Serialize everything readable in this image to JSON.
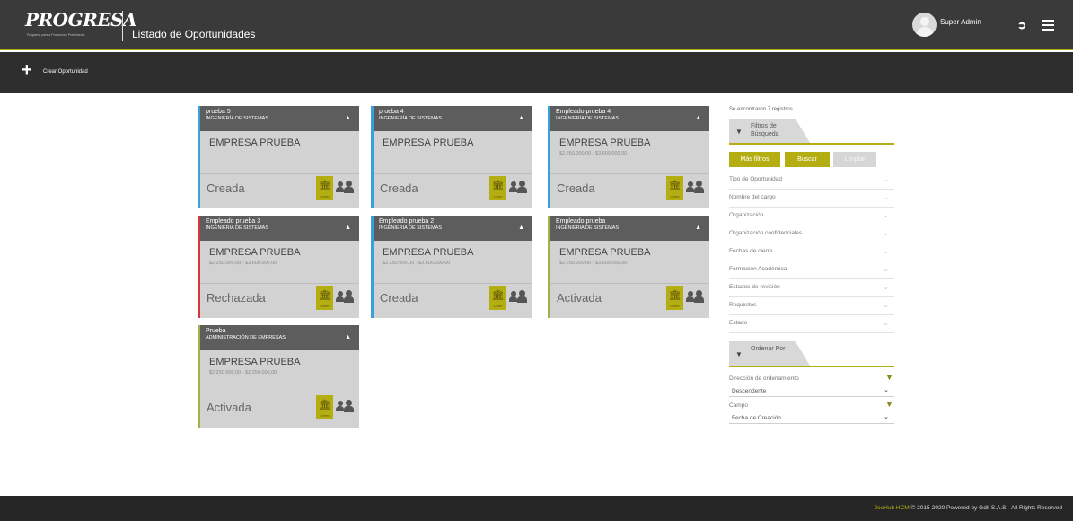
{
  "header": {
    "logo_text": "PROGRESA",
    "logo_tagline": "Programa para a Producción Profesional",
    "page_title": "Listado de Oportunidades",
    "user_name": "Super Admin",
    "accent_color": "#b5ae12"
  },
  "toolbar": {
    "create_label": "Crear Oportunidad"
  },
  "cards": [
    {
      "name": "prueba 5",
      "area": "INGENIERÍA DE SISTEMAS",
      "company": "EMPRESA PRUEBA",
      "salary": "",
      "status": "Creada",
      "bank_label": "Lorem",
      "status_color": "#3aa0d8"
    },
    {
      "name": "prueba 4",
      "area": "INGENIERÍA DE SISTEMAS",
      "company": "EMPRESA PRUEBA",
      "salary": "",
      "status": "Creada",
      "bank_label": "Lorem",
      "status_color": "#3aa0d8"
    },
    {
      "name": "Empleado prueba 4",
      "area": "INGENIERÍA DE SISTEMAS",
      "company": "EMPRESA PRUEBA",
      "salary": "$2.250.000,00 - $3.600.000,00",
      "status": "Creada",
      "bank_label": "Lorem",
      "status_color": "#3aa0d8"
    },
    {
      "name": "Empleado prueba 3",
      "area": "INGENIERÍA DE SISTEMAS",
      "company": "EMPRESA PRUEBA",
      "salary": "$2.250.000,00 - $3.600.000,00",
      "status": "Rechazada",
      "bank_label": "Lorem",
      "status_color": "#d9343a"
    },
    {
      "name": "Empleado prueba 2",
      "area": "INGENIERÍA DE SISTEMAS",
      "company": "EMPRESA PRUEBA",
      "salary": "$2.250.000,00 - $3.600.000,00",
      "status": "Creada",
      "bank_label": "Lorem",
      "status_color": "#3aa0d8"
    },
    {
      "name": "Empleado prueba",
      "area": "INGENIERÍA DE SISTEMAS",
      "company": "EMPRESA PRUEBA",
      "salary": "$2.250.000,00 - $3.600.000,00",
      "status": "Activada",
      "bank_label": "Lorem",
      "status_color": "#9ab54a"
    },
    {
      "name": "Prueba",
      "area": "ADMINISTRACIÓN DE EMPRESAS",
      "company": "EMPRESA PRUEBA",
      "salary": "$2.250.000,00 - $2.250.000,00",
      "status": "Activada",
      "bank_label": "Lorem",
      "status_color": "#9ab54a"
    }
  ],
  "filters": {
    "results_text": "Se encontraron 7 registros.",
    "tab_title": "Filtros de Búsqueda",
    "more_label": "Más filtros",
    "search_label": "Buscar",
    "clear_label": "Limpiar",
    "items": [
      "Tipo de Oportunidad",
      "Nombre del cargo",
      "Organización",
      "Organización confidenciales",
      "Fechas de cierre",
      "Formación Académica",
      "Estados de revisión",
      "Requisitos",
      "Estado"
    ]
  },
  "sort": {
    "tab_title": "Ordenar Por",
    "direction_label": "Dirección de ordenamiento",
    "direction_value": "Descendente",
    "field_label": "Campo",
    "field_value": "Fecha de Creación"
  },
  "footer": {
    "brand": "JooHub HCM",
    "text": "© 2015-2020 Powered by Gdit S.A.S  ·  All Rights Reserved"
  }
}
